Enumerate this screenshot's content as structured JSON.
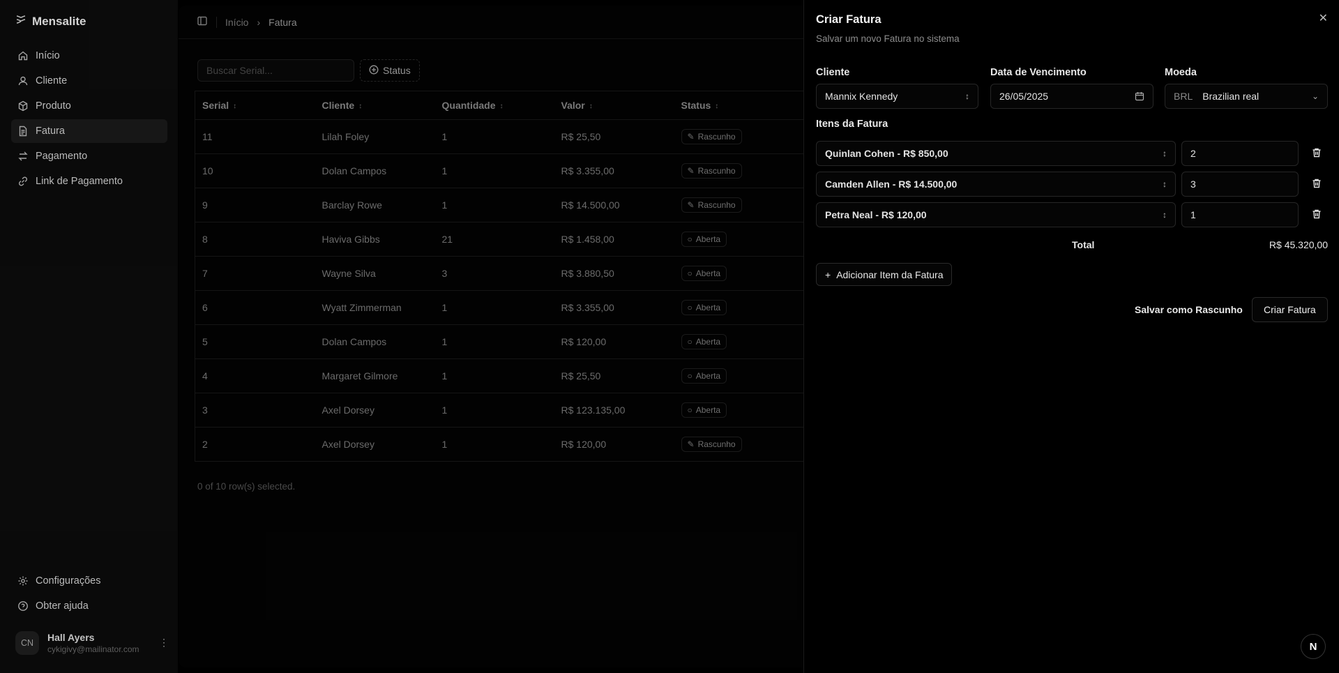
{
  "app": {
    "name": "Mensalite"
  },
  "sidebar": {
    "items": [
      {
        "label": "Início",
        "icon": "home-icon"
      },
      {
        "label": "Cliente",
        "icon": "user-icon"
      },
      {
        "label": "Produto",
        "icon": "package-icon"
      },
      {
        "label": "Fatura",
        "icon": "file-icon",
        "active": true
      },
      {
        "label": "Pagamento",
        "icon": "transfer-icon"
      },
      {
        "label": "Link de Pagamento",
        "icon": "link-icon"
      }
    ],
    "bottom": [
      {
        "label": "Configurações",
        "icon": "gear-icon"
      },
      {
        "label": "Obter ajuda",
        "icon": "help-icon"
      }
    ],
    "user": {
      "initials": "CN",
      "name": "Hall Ayers",
      "email": "cykigivy@mailinator.com"
    }
  },
  "breadcrumb": {
    "home": "Início",
    "current": "Fatura"
  },
  "toolbar": {
    "search_placeholder": "Buscar Serial...",
    "status_filter": "Status"
  },
  "table": {
    "columns": [
      "Serial",
      "Cliente",
      "Quantidade",
      "Valor",
      "Status"
    ],
    "rows": [
      [
        "11",
        "Lilah Foley",
        "1",
        "R$ 25,50",
        "Rascunho"
      ],
      [
        "10",
        "Dolan Campos",
        "1",
        "R$ 3.355,00",
        "Rascunho"
      ],
      [
        "9",
        "Barclay Rowe",
        "1",
        "R$ 14.500,00",
        "Rascunho"
      ],
      [
        "8",
        "Haviva Gibbs",
        "21",
        "R$ 1.458,00",
        "Aberta"
      ],
      [
        "7",
        "Wayne Silva",
        "3",
        "R$ 3.880,50",
        "Aberta"
      ],
      [
        "6",
        "Wyatt Zimmerman",
        "1",
        "R$ 3.355,00",
        "Aberta"
      ],
      [
        "5",
        "Dolan Campos",
        "1",
        "R$ 120,00",
        "Aberta"
      ],
      [
        "4",
        "Margaret Gilmore",
        "1",
        "R$ 25,50",
        "Aberta"
      ],
      [
        "3",
        "Axel Dorsey",
        "1",
        "R$ 123.135,00",
        "Aberta"
      ],
      [
        "2",
        "Axel Dorsey",
        "1",
        "R$ 120,00",
        "Rascunho"
      ]
    ],
    "selected_info": "0 of 10 row(s) selected."
  },
  "drawer": {
    "title": "Criar Fatura",
    "subtitle": "Salvar um novo Fatura no sistema",
    "client_label": "Cliente",
    "client_value": "Mannix Kennedy",
    "due_label": "Data de Vencimento",
    "due_value": "26/05/2025",
    "currency_label": "Moeda",
    "currency_code": "BRL",
    "currency_name": "Brazilian real",
    "items_label": "Itens da Fatura",
    "items": [
      {
        "product": "Quinlan Cohen - R$ 850,00",
        "qty": "2"
      },
      {
        "product": "Camden Allen - R$ 14.500,00",
        "qty": "3"
      },
      {
        "product": "Petra Neal - R$ 120,00",
        "qty": "1"
      }
    ],
    "total_label": "Total",
    "total_value": "R$ 45.320,00",
    "add_item": "Adicionar Item da Fatura",
    "save_draft": "Salvar como Rascunho",
    "create": "Criar Fatura"
  },
  "dev_badge": "N"
}
